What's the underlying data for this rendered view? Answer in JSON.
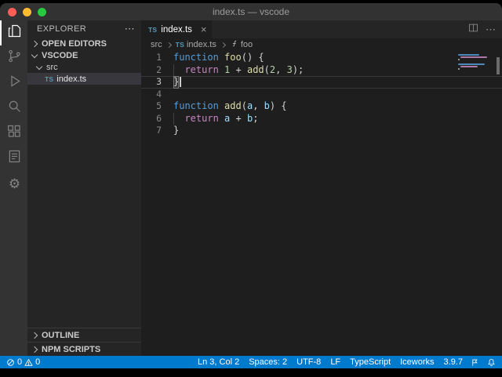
{
  "window": {
    "title": "index.ts — vscode"
  },
  "icons": {
    "close": "×",
    "more": "⋯",
    "gear": "⚙"
  },
  "sidebar": {
    "title": "EXPLORER",
    "sections": {
      "open_editors": "OPEN EDITORS",
      "workspace": "VSCODE",
      "outline": "OUTLINE",
      "npm_scripts": "NPM SCRIPTS"
    },
    "tree": {
      "folder": "src",
      "file": "index.ts",
      "file_badge": "TS"
    }
  },
  "editor_tabs": {
    "active": {
      "label": "index.ts",
      "badge": "TS"
    }
  },
  "breadcrumbs": {
    "items": [
      "src",
      "index.ts",
      "foo"
    ],
    "file_badge": "TS"
  },
  "editor": {
    "token_colors": {
      "kw": "#569cd6",
      "fn": "#dcdcaa",
      "ctl": "#c586c0",
      "num": "#b5cea8",
      "param": "#9cdcfe",
      "pl": "#d4d4d4"
    },
    "lines": [
      {
        "num": "1",
        "tokens": [
          {
            "t": "function",
            "c": "kw"
          },
          {
            "t": " ",
            "c": "pl"
          },
          {
            "t": "foo",
            "c": "fn"
          },
          {
            "t": "() {",
            "c": "pl"
          }
        ]
      },
      {
        "num": "2",
        "guide": true,
        "tokens": [
          {
            "t": "  ",
            "c": "pl"
          },
          {
            "t": "return",
            "c": "ctl"
          },
          {
            "t": " ",
            "c": "pl"
          },
          {
            "t": "1",
            "c": "num"
          },
          {
            "t": " + ",
            "c": "pl"
          },
          {
            "t": "add",
            "c": "fn"
          },
          {
            "t": "(",
            "c": "pl"
          },
          {
            "t": "2",
            "c": "num"
          },
          {
            "t": ", ",
            "c": "pl"
          },
          {
            "t": "3",
            "c": "num"
          },
          {
            "t": ");",
            "c": "pl"
          }
        ]
      },
      {
        "num": "3",
        "current": true,
        "cursor": true,
        "tokens": [
          {
            "t": "}",
            "c": "pl",
            "match": true
          }
        ]
      },
      {
        "num": "4",
        "tokens": []
      },
      {
        "num": "5",
        "tokens": [
          {
            "t": "function",
            "c": "kw"
          },
          {
            "t": " ",
            "c": "pl"
          },
          {
            "t": "add",
            "c": "fn"
          },
          {
            "t": "(",
            "c": "pl"
          },
          {
            "t": "a",
            "c": "param"
          },
          {
            "t": ", ",
            "c": "pl"
          },
          {
            "t": "b",
            "c": "param"
          },
          {
            "t": ") {",
            "c": "pl"
          }
        ]
      },
      {
        "num": "6",
        "guide": true,
        "tokens": [
          {
            "t": "  ",
            "c": "pl"
          },
          {
            "t": "return",
            "c": "ctl"
          },
          {
            "t": " ",
            "c": "pl"
          },
          {
            "t": "a",
            "c": "param"
          },
          {
            "t": " + ",
            "c": "pl"
          },
          {
            "t": "b",
            "c": "param"
          },
          {
            "t": ";",
            "c": "pl"
          }
        ]
      },
      {
        "num": "7",
        "tokens": [
          {
            "t": "}",
            "c": "pl"
          }
        ]
      }
    ]
  },
  "status_bar": {
    "errors": "0",
    "warnings": "0",
    "right_items": [
      {
        "name": "cursor-position",
        "label": "Ln 3, Col 2"
      },
      {
        "name": "indentation",
        "label": "Spaces: 2"
      },
      {
        "name": "encoding",
        "label": "UTF-8"
      },
      {
        "name": "eol",
        "label": "LF"
      },
      {
        "name": "language-mode",
        "label": "TypeScript"
      },
      {
        "name": "iceworks",
        "label": "Iceworks"
      },
      {
        "name": "ts-version",
        "label": "3.9.7"
      }
    ]
  },
  "colors": {
    "status_bar_bg": "#007acc",
    "activity_bar_bg": "#333333",
    "sidebar_bg": "#252526",
    "editor_bg": "#1e1e1e",
    "titlebar_bg": "#323233",
    "file_badge": "#519aba",
    "selection_row": "#37373d"
  }
}
